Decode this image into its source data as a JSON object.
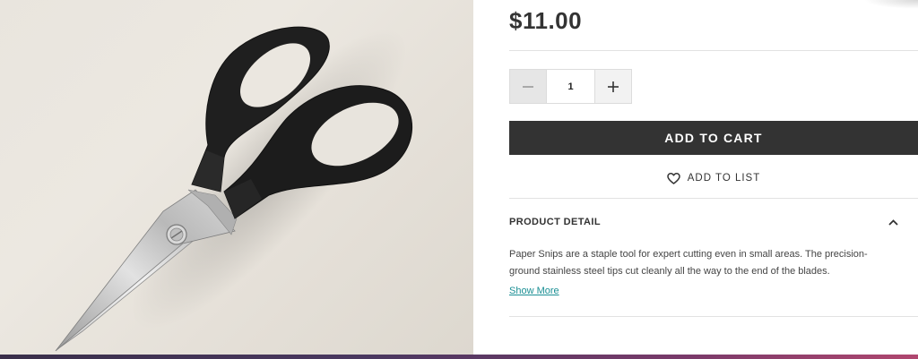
{
  "product": {
    "image_alt": "Paper Snips",
    "price": "$11.00"
  },
  "quantity": {
    "value": "1",
    "decrease_icon": "minus-icon",
    "increase_icon": "plus-icon"
  },
  "actions": {
    "add_to_cart_label": "ADD TO CART",
    "add_to_list_label": "ADD TO LIST",
    "add_to_list_icon": "heart-icon"
  },
  "product_detail": {
    "title": "PRODUCT DETAIL",
    "toggle_icon": "chevron-up-icon",
    "description": "Paper Snips are a staple tool for expert cutting even in small areas. The precision-ground stainless steel tips cut cleanly all the way to the end of the blades.",
    "show_more_label": "Show More"
  },
  "colors": {
    "button_dark": "#333333",
    "link": "#1a8f94"
  }
}
